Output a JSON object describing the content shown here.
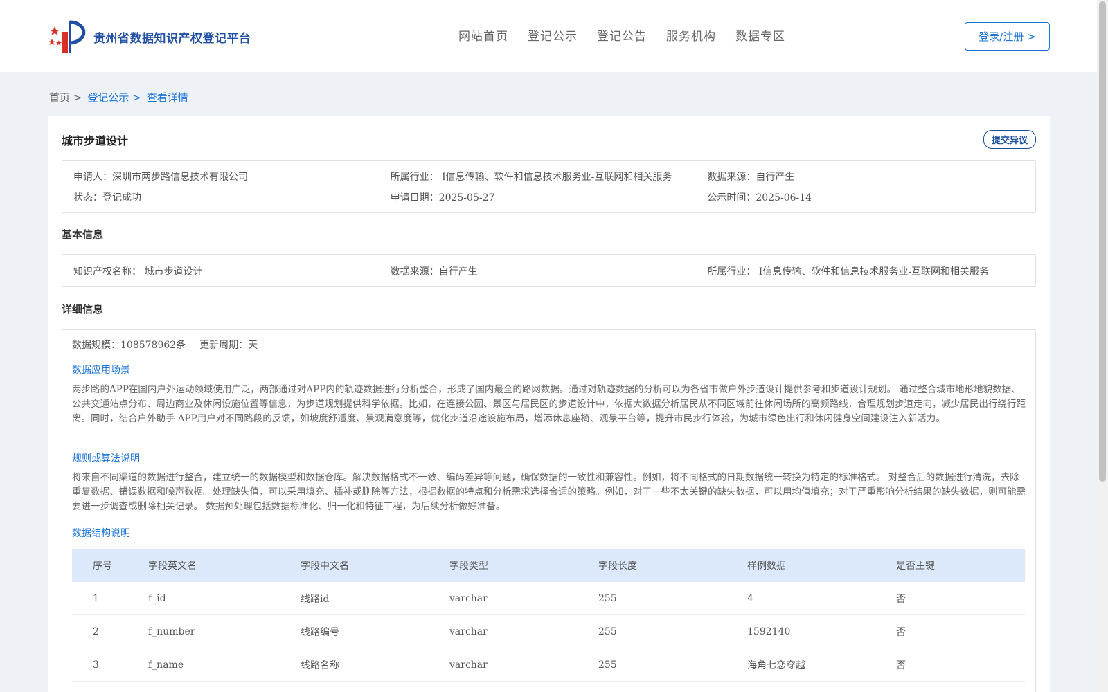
{
  "header": {
    "logo_text": "贵州省数据知识产权登记平台",
    "nav": [
      "网站首页",
      "登记公示",
      "登记公告",
      "服务机构",
      "数据专区"
    ],
    "login_label": "登录/注册 >"
  },
  "breadcrumb": {
    "home": "首页 >",
    "section": "登记公示 >",
    "current": "查看详情"
  },
  "record": {
    "title": "城市步道设计",
    "objection_label": "提交异议",
    "summary": {
      "applicant": "申请人：深圳市两步路信息技术有限公司",
      "industry": "所属行业： I信息传输、软件和信息技术服务业-互联网和相关服务",
      "source": "数据来源：自行产生",
      "status": "状态：登记成功",
      "apply_date": "申请日期：2025-05-27",
      "publish_date": "公示时间：2025-06-14"
    }
  },
  "basic": {
    "section_title": "基本信息",
    "ip_name": "知识产权名称： 城市步道设计",
    "source": "数据来源：自行产生",
    "industry": "所属行业： I信息传输、软件和信息技术服务业-互联网和相关服务"
  },
  "detail": {
    "section_title": "详细信息",
    "scale": "数据规模：108578962条",
    "cycle": "更新周期：天",
    "scenario_title": "数据应用场景",
    "scenario_text": "两步路的APP在国内户外运动领域使用广泛，两部通过对APP内的轨迹数据进行分析整合，形成了国内最全的路网数据。通过对轨迹数据的分析可以为各省市做户外步道设计提供参考和步道设计规划。 通过整合城市地形地貌数据、公共交通站点分布、周边商业及休闲设施位置等信息，为步道规划提供科学依据。比如，在连接公园、景区与居民区的步道设计中，依据大数据分析居民从不同区域前往休闲场所的高频路线，合理规划步道走向，减少居民出行绕行距离。同时，结合户外助手 APP用户对不同路段的反馈，如坡度舒适度、景观满意度等，优化步道沿途设施布局，增添休息座椅、观景平台等，提升市民步行体验，为城市绿色出行和休闲健身空间建设注入新活力。",
    "rule_title": "规则或算法说明",
    "rule_text": "将来自不同渠道的数据进行整合，建立统一的数据模型和数据仓库。解决数据格式不一致、编码差异等问题，确保数据的一致性和兼容性。例如，将不同格式的日期数据统一转换为特定的标准格式。 对整合后的数据进行清洗，去除重复数据、错误数据和噪声数据。处理缺失值，可以采用填充、插补或删除等方法，根据数据的特点和分析需求选择合适的策略。例如，对于一些不太关键的缺失数据，可以用均值填充；对于严重影响分析结果的缺失数据，则可能需要进一步调查或删除相关记录。 数据预处理包括数据标准化、归一化和特征工程，为后续分析做好准备。",
    "structure_title": "数据结构说明"
  },
  "table": {
    "headers": [
      "序号",
      "字段英文名",
      "字段中文名",
      "字段类型",
      "字段长度",
      "样例数据",
      "是否主键"
    ],
    "rows": [
      [
        "1",
        "f_id",
        "线路id",
        "varchar",
        "255",
        "4",
        "否"
      ],
      [
        "2",
        "f_number",
        "线路编号",
        "varchar",
        "255",
        "1592140",
        "否"
      ],
      [
        "3",
        "f_name",
        "线路名称",
        "varchar",
        "255",
        "海角七恋穿越",
        "否"
      ]
    ]
  },
  "colors": {
    "brand_blue": "#1f4fa3",
    "link_blue": "#1a73d9",
    "table_header_bg": "#dce9fb",
    "page_bg": "#eef2f6"
  }
}
